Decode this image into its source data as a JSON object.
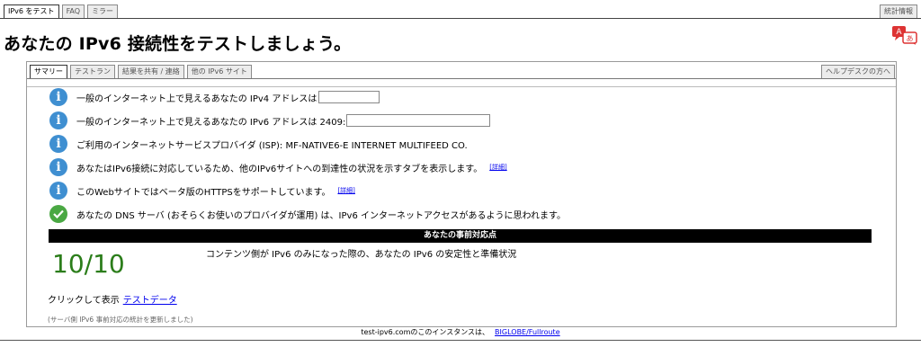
{
  "top_tabs": [
    "IPv6 をテスト",
    "FAQ",
    "ミラー"
  ],
  "stats_tab": "統計情報",
  "page_title": "あなたの IPv6 接続性をテストしましょう。",
  "sub_tabs": [
    "サマリー",
    "テストラン",
    "結果を共有 / 連絡",
    "他の IPv6 サイト"
  ],
  "help_tab": "ヘルプデスクの方へ",
  "info_rows": {
    "ipv4": "一般のインターネット上で見えるあなたの IPv4 アドレスは",
    "ipv6": "一般のインターネット上で見えるあなたの IPv6 アドレスは 2409:",
    "isp": "ご利用のインターネットサービスプロバイダ (ISP): MF-NATIVE6-E INTERNET MULTIFEED CO.",
    "ipv6_tabs": "あなたはIPv6接続に対応しているため、他のIPv6サイトへの到達性の状況を示すタブを表示します。",
    "https": "このWebサイトではベータ版のHTTPSをサポートしています。",
    "dns": "あなたの DNS サーバ (おそらくお使いのプロバイダが運用) は、IPv6 インターネットアクセスがあるように思われます。"
  },
  "more_link": "[詳細]",
  "readiness_header": "あなたの事前対応点",
  "score": "10/10",
  "score_desc": "コンテンツ側が IPv6 のみになった際の、あなたの IPv6 の安定性と準備状況",
  "click_prefix": "クリックして表示",
  "test_data_link": "テストデータ",
  "footnote": "(サーバ側 IPv6 事前対応の統計を更新しました)",
  "footer_text": "test-ipv6.comのこのインスタンスは、",
  "footer_link": "BIGLOBE/Fullroute",
  "icons": [
    "info-icon",
    "check-icon",
    "translate-icon"
  ],
  "colors": {
    "info": "#3f8fd1",
    "check": "#4aa843",
    "score": "#2b7d1a",
    "link": "#0000ee"
  }
}
